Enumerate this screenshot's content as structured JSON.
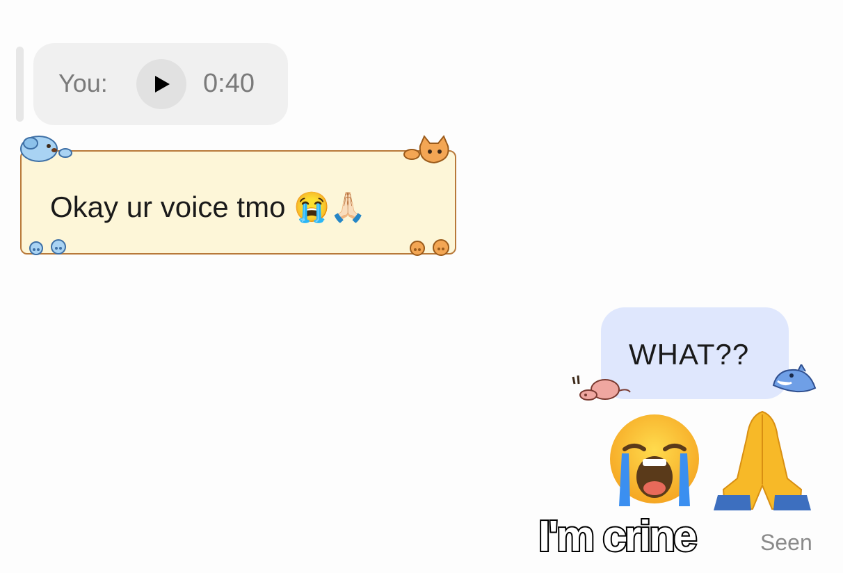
{
  "reply": {
    "sender_label": "You:",
    "duration": "0:40"
  },
  "received": {
    "text": "Okay ur voice tmo 😭🙏🏻"
  },
  "sent": {
    "text": "WHAT??"
  },
  "overlay_caption": "I'm crine",
  "status": "Seen",
  "icons": [
    "play-icon",
    "dog-sticker-icon",
    "cat-sticker-icon",
    "paw-print-icon",
    "pig-sticker-icon",
    "shark-sticker-icon",
    "loudly-crying-face-emoji",
    "folded-hands-emoji"
  ],
  "colors": {
    "received_bubble_bg": "#fdf6d8",
    "received_bubble_border": "#b8793a",
    "sent_bubble_bg": "#dfe7fd",
    "reply_pill_bg": "#f0f0f0"
  }
}
